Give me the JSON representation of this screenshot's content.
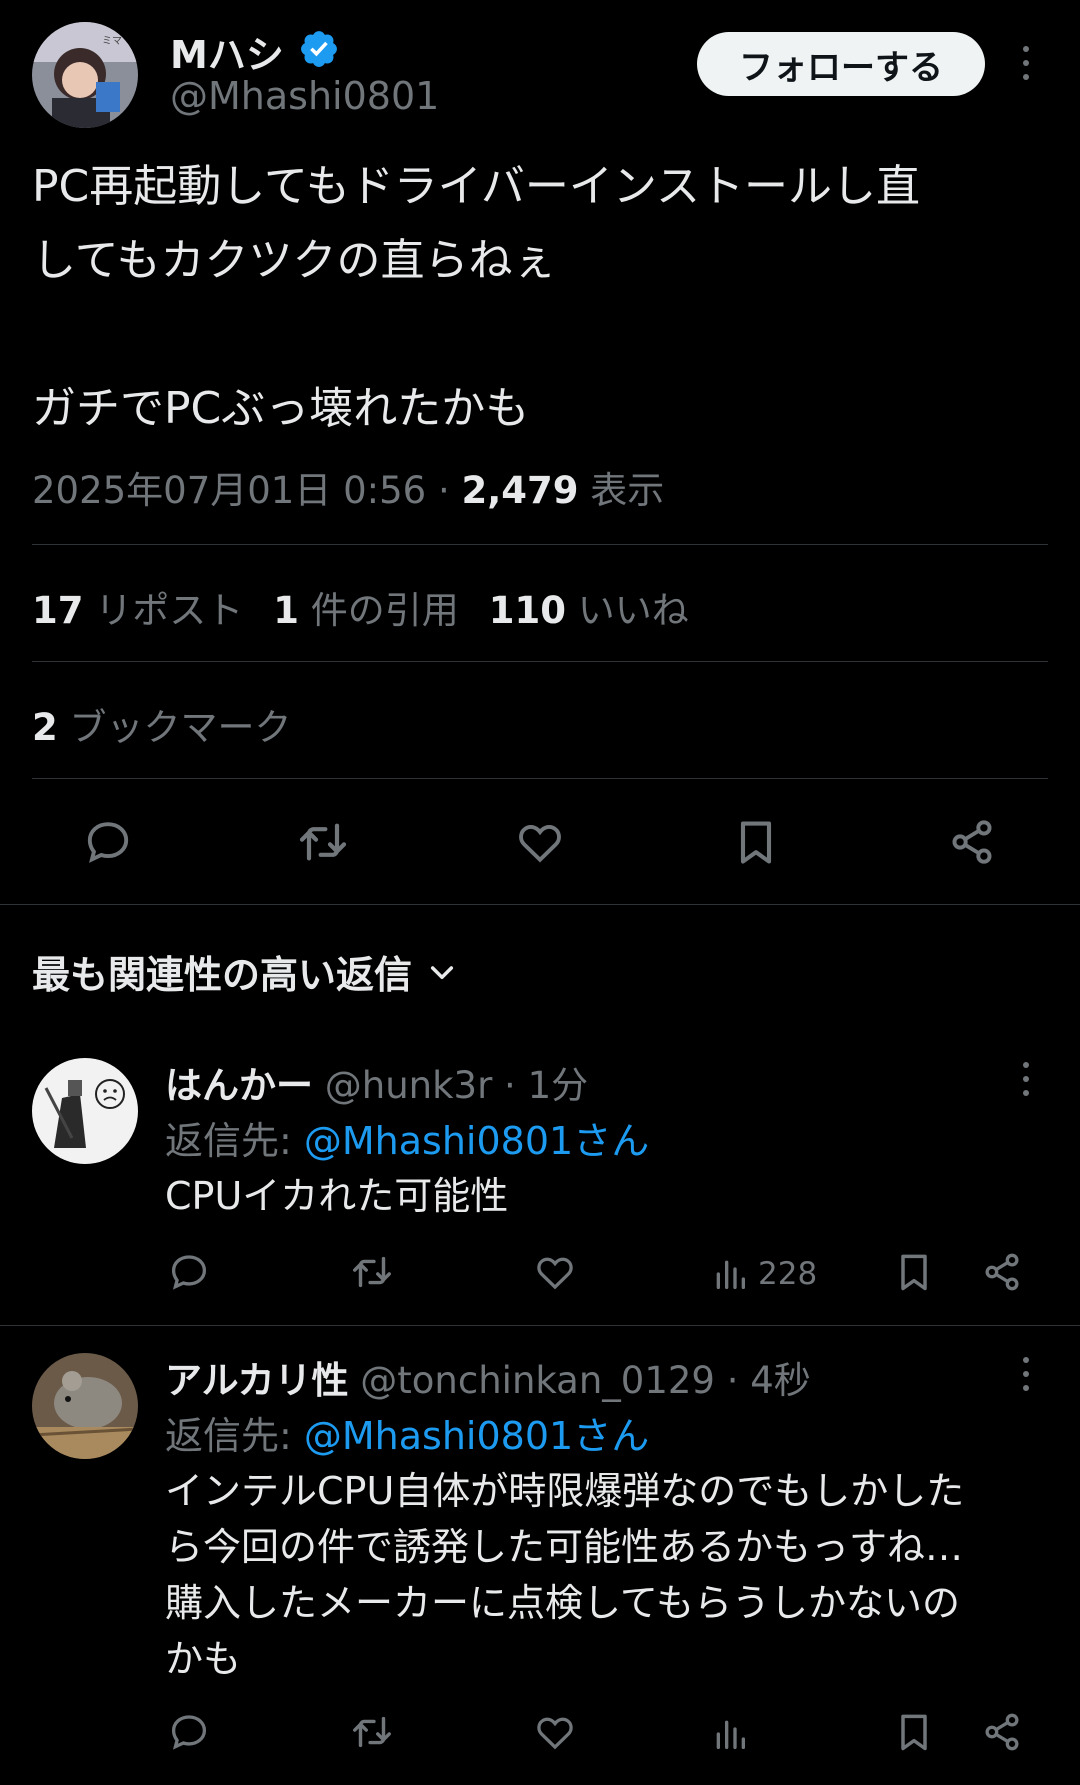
{
  "post": {
    "author": {
      "name": "Mハシ",
      "handle": "@Mhashi0801",
      "verified": true
    },
    "follow_label": "フォローする",
    "text": "PC再起動してもドライバーインストールし直\nしてもカクツクの直らねぇ\n\nガチでPCぶっ壊れたかも",
    "timestamp": "2025年07月01日 0:56",
    "separator": " · ",
    "views_count": "2,479",
    "views_label": " 表示",
    "stats": {
      "reposts_count": "17",
      "reposts_label": " リポスト",
      "quotes_count": "1",
      "quotes_label": " 件の引用",
      "likes_count": "110",
      "likes_label": " いいね",
      "bookmarks_count": "2",
      "bookmarks_label": " ブックマーク"
    },
    "actions": [
      "reply-icon",
      "repost-icon",
      "like-icon",
      "bookmark-icon",
      "share-icon"
    ]
  },
  "replies_header": {
    "label": "最も関連性の高い返信",
    "icon": "chevron-down-icon"
  },
  "replies": [
    {
      "name": "はんかー",
      "handle": " @hunk3r · 1分",
      "reply_to_prefix": "返信先: ",
      "reply_to_mention": "@Mhashi0801さん",
      "text": "CPUイカれた可能性",
      "views": "228"
    },
    {
      "name": "アルカリ性",
      "handle": " @tonchinkan_0129 · 4秒",
      "reply_to_prefix": "返信先: ",
      "reply_to_mention": "@Mhashi0801さん",
      "text": "インテルCPU自体が時限爆弾なのでもしかした\nら今回の件で誘発した可能性あるかもっすね…\n購入したメーカーに点検してもらうしかないの\nかも",
      "views": ""
    }
  ],
  "colors": {
    "background": "#000000",
    "text": "#e7e9ea",
    "secondary": "#71767b",
    "accent": "#1d9bf0",
    "divider": "#2f3336"
  }
}
